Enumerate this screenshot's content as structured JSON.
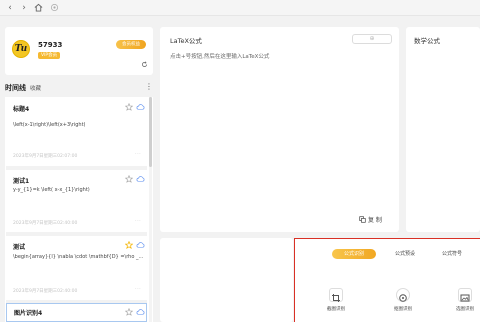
{
  "topbar": {
    "back_icon": "‹",
    "forward_icon": "›",
    "home_icon": "home-icon"
  },
  "user": {
    "avatar_glyph": "Tu",
    "id": "57933",
    "vip_badge": "VIP会员",
    "vip_button": "会员权益"
  },
  "timeline": {
    "title": "时间线",
    "favorites_tab": "收藏",
    "more_glyph": "⋮"
  },
  "items": [
    {
      "title": "标题4",
      "formula": "\\left(x-1\\right)\\left(x+3\\right)",
      "time": "2023年9月7日星期三02:07:00",
      "dots": "···",
      "starred": false
    },
    {
      "title": "测试1",
      "formula": "y-y_{1}=k \\left( x-x_{1}\\right)",
      "time": "2023年9月7日星期三02:40:00",
      "dots": "···",
      "starred": false
    },
    {
      "title": "测试",
      "formula": "\\begin{array}{l} \\nabla \\cdot \\mathbf{D} =\\rho _...",
      "time": "2023年9月7日星期三02:40:00",
      "dots": "···",
      "starred": true
    },
    {
      "title": "图片识别4",
      "formula": "",
      "time": "",
      "dots": "",
      "starred": false
    }
  ],
  "latex": {
    "title": "LaTeX公式",
    "hint": "点击+号按钮,然后在这里输入LaTeX公式",
    "add_glyph": "⊕",
    "copy_label": "复 制"
  },
  "math": {
    "title": "数学公式"
  },
  "recognition": {
    "tabs": [
      "公式识别",
      "公式预设",
      "公式符号"
    ],
    "actions": [
      "截图识别",
      "抠图识别",
      "选图识别"
    ]
  },
  "colors": {
    "accent": "#f3ab28",
    "highlight_border": "#d93025",
    "star_active": "#f4b400",
    "cloud": "#5b8def"
  }
}
